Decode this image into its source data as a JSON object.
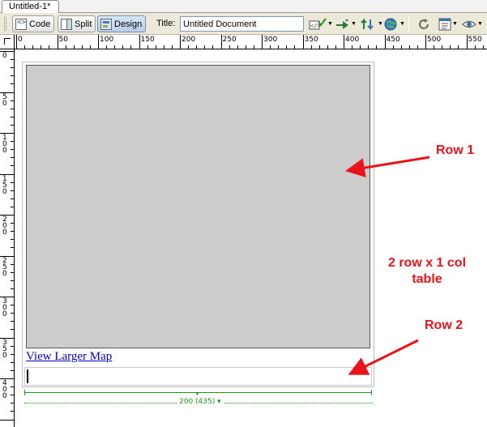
{
  "document_tab": {
    "label": "Untitled-1*"
  },
  "toolbar": {
    "code_label": "Code",
    "split_label": "Split",
    "design_label": "Design",
    "title_label": "Title:",
    "title_value": "Untitled Document",
    "icons": [
      "validate-markup-icon",
      "file-management-icon",
      "preview-in-browser-icon",
      "refresh-icon",
      "view-options-icon",
      "visual-aids-icon"
    ]
  },
  "ruler": {
    "top_labels": [
      "0",
      "50",
      "100",
      "150",
      "200",
      "250",
      "300",
      "350",
      "400",
      "450",
      "500",
      "550"
    ],
    "left_labels": [
      "0",
      "50",
      "100",
      "150",
      "200",
      "250",
      "300",
      "350",
      "400"
    ]
  },
  "page": {
    "map_link_text": "View Larger Map",
    "table_width_label": "200 (435)"
  },
  "annotations": {
    "row1": "Row 1",
    "table_caption_line1": "2 row x 1 col",
    "table_caption_line2": "table",
    "row2": "Row 2",
    "color": "#e8141a"
  },
  "colors": {
    "map_placeholder": "#cccccc",
    "width_guide": "#1a9a1a",
    "link": "#0000cc"
  }
}
